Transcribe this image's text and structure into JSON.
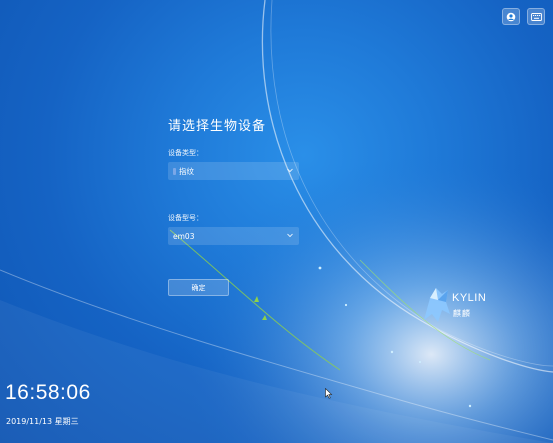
{
  "topbar": {
    "user_icon": "user-switch-icon",
    "keyboard_icon": "keyboard-icon"
  },
  "dialog": {
    "title": "请选择生物设备",
    "device_type_label": "设备类型：",
    "device_type_value": "指纹",
    "device_model_label": "设备型号：",
    "device_model_value": "em03",
    "confirm_label": "确定"
  },
  "clock": {
    "time": "16:58:06",
    "date": "2019/11/13 星期三"
  },
  "brand": {
    "logo_text": "KYLIN",
    "logo_sub": "麒麟",
    "logo_icon": "kylin-logo-icon"
  },
  "colors": {
    "background": "#1a6fd0",
    "accent_green": "#8ed14a"
  }
}
